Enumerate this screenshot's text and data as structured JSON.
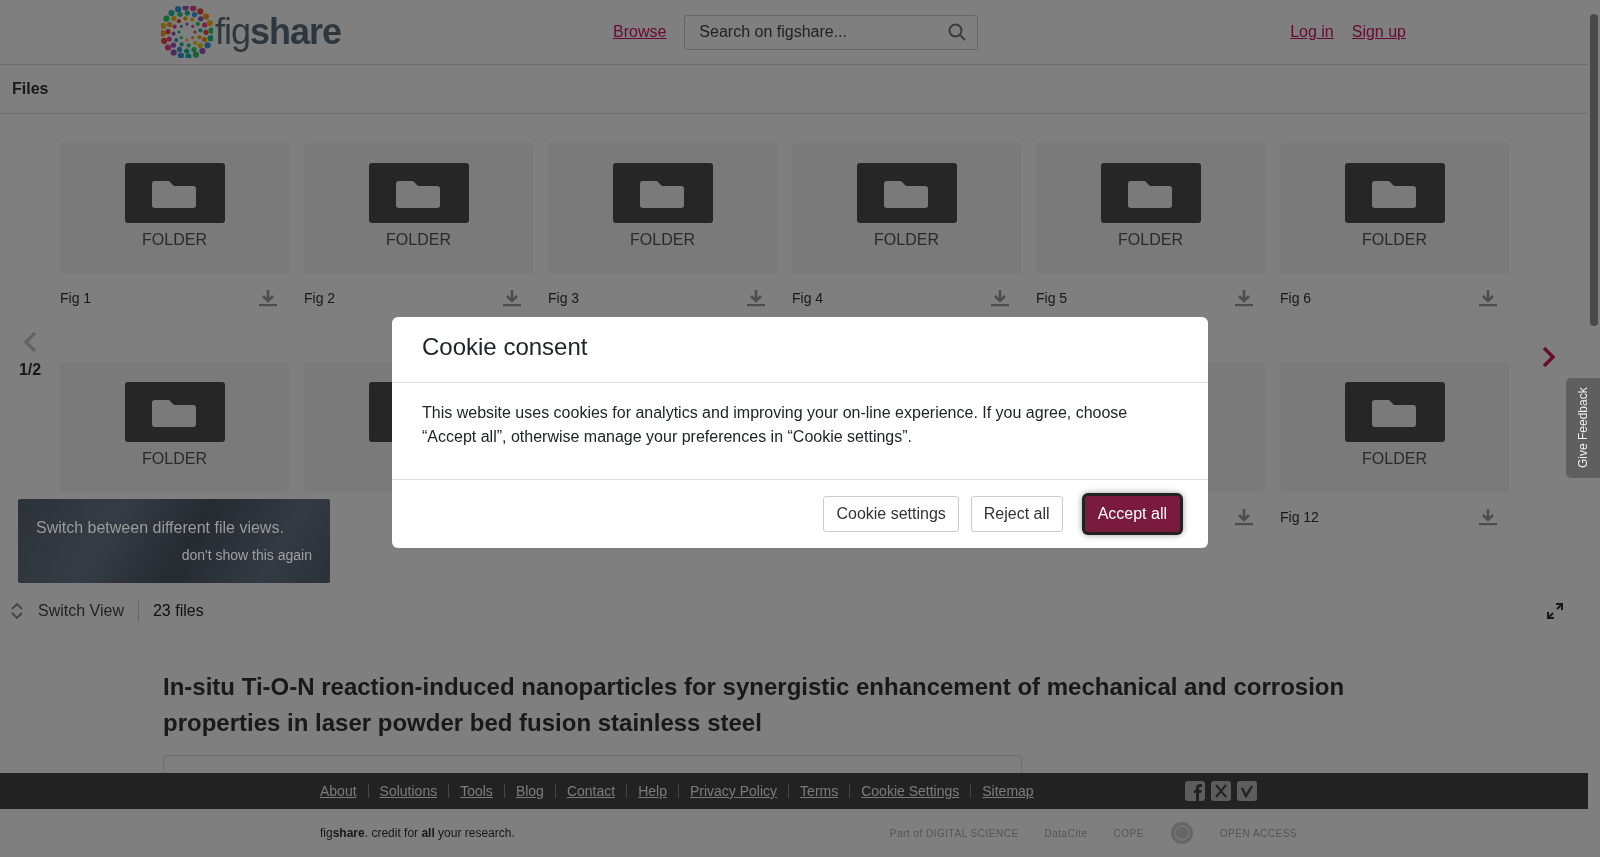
{
  "header": {
    "logo": {
      "light": "fig",
      "bold": "share"
    },
    "nav_link": "Browse",
    "search": {
      "placeholder": "Search on figshare..."
    },
    "auth_links": [
      "Log in",
      "Sign up"
    ]
  },
  "files_panel": {
    "title": "Files",
    "pager": {
      "label": "1/2",
      "prev_disabled": true,
      "next_disabled": false
    },
    "rows": [
      [
        {
          "kind": "folder",
          "label": "FOLDER",
          "name": "Fig 1",
          "download": true
        },
        {
          "kind": "folder",
          "label": "FOLDER",
          "name": "Fig 2",
          "download": true
        },
        {
          "kind": "folder",
          "label": "FOLDER",
          "name": "Fig 3",
          "download": true
        },
        {
          "kind": "folder",
          "label": "FOLDER",
          "name": "Fig 4",
          "download": true
        },
        {
          "kind": "folder",
          "label": "FOLDER",
          "name": "Fig 5",
          "download": true
        },
        {
          "kind": "folder",
          "label": "FOLDER",
          "name": "Fig 6",
          "download": true
        }
      ],
      [
        {
          "kind": "folder",
          "label": "FOLDER"
        },
        {
          "kind": "folder"
        },
        {
          "kind": "covered"
        },
        {
          "kind": "covered"
        },
        {
          "kind": "tile",
          "download": true
        },
        {
          "kind": "folder",
          "label": "FOLDER",
          "name": "Fig 12",
          "download": true
        }
      ]
    ],
    "toolbar": {
      "switch_view": "Switch View",
      "file_count": "23 files"
    }
  },
  "tooltip": {
    "text": "Switch between different file views.",
    "dismiss": "don't show this again"
  },
  "article": {
    "title": "In-situ Ti-O-N reaction-induced nanoparticles for synergistic enhancement of mechanical and corrosion properties in laser powder bed fusion stainless steel"
  },
  "feedback_tab": "Give Feedback",
  "footer": {
    "links": [
      "About",
      "Solutions",
      "Tools",
      "Blog",
      "Contact",
      "Help",
      "Privacy Policy",
      "Terms",
      "Cookie Settings",
      "Sitemap"
    ],
    "socials": [
      {
        "kind": "f"
      },
      {
        "kind": "x"
      },
      {
        "kind": "v"
      }
    ],
    "tagline": "fig**share**. credit for **all** your research.",
    "partners": [
      {
        "kind": "text",
        "text": "Part of DIGITAL SCIENCE"
      },
      {
        "kind": "text",
        "text": "DataCite"
      },
      {
        "kind": "text",
        "text": "COPE"
      },
      {
        "kind": "seal"
      },
      {
        "kind": "text",
        "text": "OPEN ACCESS"
      }
    ]
  },
  "cookie_dialog": {
    "title": "Cookie consent",
    "message": "This website uses cookies for analytics and improving your on-line experience. If you agree, choose “Accept all”, otherwise manage your preferences in “Cookie settings”.",
    "buttons": [
      {
        "label": "Cookie settings",
        "kind": "secondary",
        "focused": false
      },
      {
        "label": "Reject all",
        "kind": "secondary",
        "focused": false
      },
      {
        "label": "Accept all",
        "kind": "primary",
        "focused": true
      }
    ]
  }
}
